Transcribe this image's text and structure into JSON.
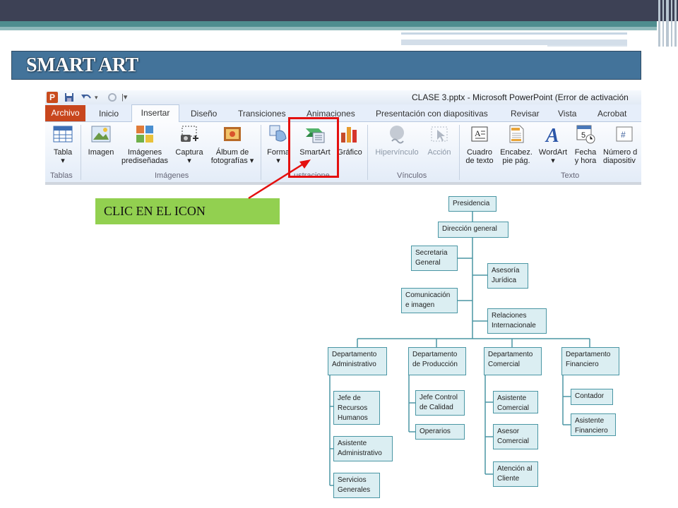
{
  "slide": {
    "title": "SMART ART",
    "callout": "CLIC EN EL ICON",
    "colors": {
      "title_bg": "#43739a",
      "callout_bg": "#92d050",
      "highlight": "#e4100f",
      "topbar": "#3d4155",
      "teal": "#4f8d8f"
    }
  },
  "ribbon": {
    "window_title": "CLASE 3.pptx - Microsoft PowerPoint (Error de activación",
    "quick_access": [
      "powerpoint-logo-icon",
      "save-icon",
      "undo-icon",
      "redo-icon",
      "customize-icon"
    ],
    "file_tab": "Archivo",
    "tabs": [
      "Inicio",
      "Insertar",
      "Diseño",
      "Transiciones",
      "Animaciones",
      "Presentación con diapositivas",
      "Revisar",
      "Vista",
      "Acrobat"
    ],
    "active_tab": "Insertar",
    "groups": [
      {
        "label": "Tablas",
        "buttons": [
          {
            "label": "Tabla",
            "icon": "table-icon"
          }
        ]
      },
      {
        "label": "Imágenes",
        "buttons": [
          {
            "label": "Imagen",
            "icon": "picture-icon"
          },
          {
            "label": "Imágenes prediseñadas",
            "icon": "clipart-icon"
          },
          {
            "label": "Captura",
            "icon": "screenshot-icon"
          },
          {
            "label": "Álbum de fotografías",
            "icon": "photo-album-icon"
          }
        ]
      },
      {
        "label": "Ilustraciones",
        "buttons": [
          {
            "label": "Formas",
            "icon": "shapes-icon"
          },
          {
            "label": "SmartArt",
            "icon": "smartart-icon"
          },
          {
            "label": "Gráfico",
            "icon": "chart-icon"
          }
        ]
      },
      {
        "label": "Vínculos",
        "buttons": [
          {
            "label": "Hipervínculo",
            "icon": "hyperlink-icon",
            "disabled": true
          },
          {
            "label": "Acción",
            "icon": "action-icon",
            "disabled": true
          }
        ]
      },
      {
        "label": "Texto",
        "buttons": [
          {
            "label": "Cuadro de texto",
            "icon": "textbox-icon"
          },
          {
            "label": "Encabez. pie pág.",
            "icon": "header-footer-icon"
          },
          {
            "label": "WordArt",
            "icon": "wordart-icon"
          },
          {
            "label": "Fecha y hora",
            "icon": "date-time-icon"
          },
          {
            "label": "Número de diapositiva",
            "icon": "slide-number-icon"
          }
        ]
      }
    ],
    "display": {
      "tabla": "Tabla",
      "imagen": "Imagen",
      "imagenes1": "Imágenes",
      "imagenes2": "prediseñadas",
      "captura": "Captura",
      "album1": "Álbum de",
      "album2": "fotografías",
      "formas": "Forma",
      "smartart": "SmartArt",
      "grafico": "Gráfico",
      "hipervinculo": "Hipervínculo",
      "accion": "Acción",
      "cuadro1": "Cuadro",
      "cuadro2": "de texto",
      "encabez1": "Encabez.",
      "encabez2": "pie pág.",
      "wordart": "WordArt",
      "fecha1": "Fecha",
      "fecha2": "y hora",
      "numero1": "Número d",
      "numero2": "diapositiv",
      "g_tablas": "Tablas",
      "g_imagenes": "Imágenes",
      "g_ilustraciones": "ustracione",
      "g_vinculos": "Vínculos",
      "g_texto": "Texto"
    }
  },
  "org_chart": {
    "top": [
      "Presidencia",
      "Dirección general"
    ],
    "staff_left": [
      "Secretaria General",
      "Comunicación e imagen"
    ],
    "staff_right": [
      "Asesoría Jurídica",
      "Relaciones Internacionale"
    ],
    "departments": [
      {
        "name": "Departamento Administrativo",
        "children": [
          "Jefe de Recursos Humanos",
          "Asistente Administrativo",
          "Servicios Generales"
        ]
      },
      {
        "name": "Departamento de Producción",
        "children": [
          "Jefe Control de Calidad",
          "Operarios"
        ]
      },
      {
        "name": "Departamento Comercial",
        "children": [
          "Asistente Comercial",
          "Asesor Comercial",
          "Atención al Cliente"
        ]
      },
      {
        "name": "Departamento Financiero",
        "children": [
          "Contador",
          "Asistente Financiero"
        ]
      }
    ]
  }
}
